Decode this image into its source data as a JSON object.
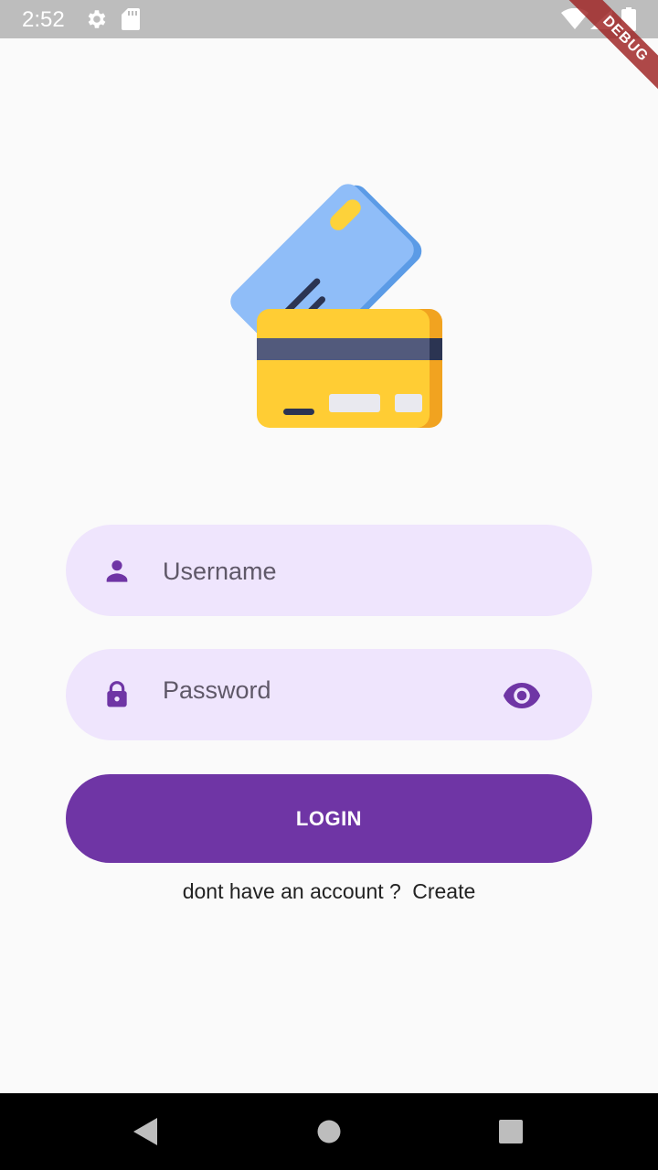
{
  "status_bar": {
    "time": "2:52",
    "icons": [
      "settings-icon",
      "sd-card-icon",
      "wifi-icon",
      "signal-icon",
      "battery-icon"
    ]
  },
  "debug_banner": {
    "label": "DEBUG"
  },
  "login_form": {
    "username": {
      "placeholder": "Username",
      "value": "",
      "icon": "person-icon"
    },
    "password": {
      "placeholder": "Password",
      "value": "",
      "icon": "lock-icon",
      "toggle_icon": "eye-icon"
    },
    "login_button": {
      "label": "LOGIN"
    },
    "signup_prompt": {
      "text": "dont have an account ?",
      "link_label": "Create"
    }
  },
  "nav_bar": {
    "icons": [
      "back-icon",
      "home-icon",
      "recents-icon"
    ]
  },
  "colors": {
    "primary": "#6f35a5",
    "field_background": "#efe5fd",
    "background": "#fafafa",
    "status_bar": "#bdbdbd"
  }
}
